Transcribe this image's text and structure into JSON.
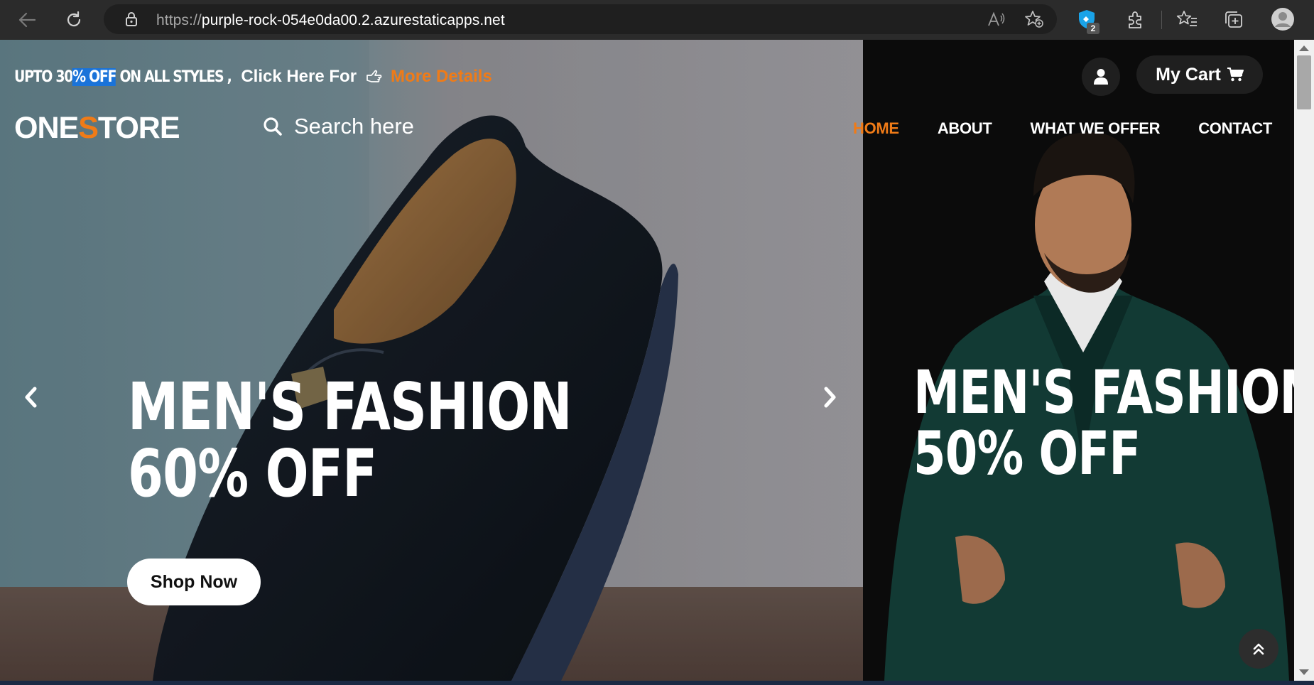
{
  "browser": {
    "url_scheme": "https://",
    "url_host": "purple-rock-054e0da00.2.azurestaticapps.net",
    "extension_badge": "2"
  },
  "header": {
    "promo_prefix": "UPTO 30",
    "promo_highlight": "% OFF",
    "promo_suffix": " ON ALL STYLES ,",
    "promo_click": "Click Here For",
    "promo_more": "More Details",
    "cart_label": "My Cart",
    "logo_part1": "ONE",
    "logo_accent": "S",
    "logo_part2": "TORE",
    "search_placeholder": "Search here",
    "nav": [
      {
        "label": "HOME",
        "active": true
      },
      {
        "label": "ABOUT"
      },
      {
        "label": "WHAT WE OFFER"
      },
      {
        "label": "CONTACT"
      }
    ]
  },
  "hero": {
    "left_line1": "MEN'S FASHION",
    "left_line2": "60% OFF",
    "right_line1": "MEN'S FASHION",
    "right_line2": "50% OFF",
    "shop_button": "Shop Now"
  },
  "colors": {
    "accent": "#f07b17",
    "highlight": "#1a73d9"
  },
  "icons": [
    "back-icon",
    "refresh-icon",
    "lock-icon",
    "read-aloud-icon",
    "add-favorite-icon",
    "extension-shield-icon",
    "extensions-icon",
    "favorites-icon",
    "collections-icon",
    "profile-icon",
    "pointing-hand-icon",
    "user-icon",
    "cart-icon",
    "search-icon",
    "chevron-left-icon",
    "chevron-right-icon",
    "double-chevron-up-icon"
  ]
}
